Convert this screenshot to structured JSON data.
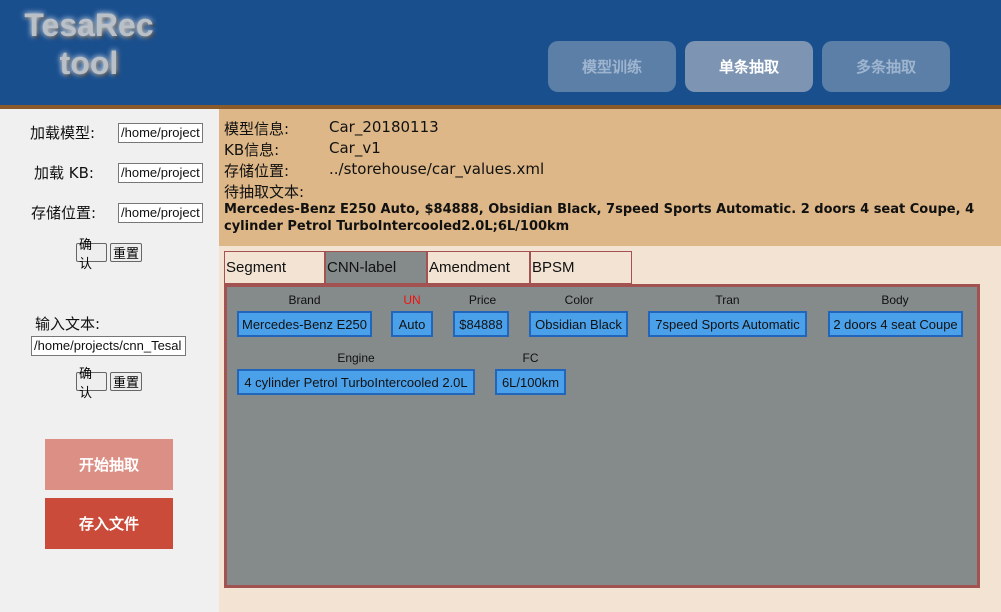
{
  "header": {
    "logo_line1": "TesaRec",
    "logo_line2": "tool",
    "nav_train": "模型训练",
    "nav_single": "单条抽取",
    "nav_multi": "多条抽取"
  },
  "left": {
    "load_model_label": "加载模型:",
    "load_model_value": "/home/project",
    "load_kb_label": "加载 KB:",
    "load_kb_value": "/home/project",
    "save_path_label": "存储位置:",
    "save_path_value": "/home/project",
    "confirm_label": "确认",
    "reset_label": "重置",
    "input_text_label": "输入文本:",
    "input_text_value": "/home/projects/cnn_Tesal",
    "confirm2_label": "确认",
    "reset2_label": "重置",
    "start_extract": "开始抽取",
    "save_file": "存入文件"
  },
  "info": {
    "model_label": "模型信息:",
    "model_value": "Car_20180113",
    "kb_label": "KB信息:",
    "kb_value": "Car_v1",
    "store_label": "存储位置:",
    "store_value": "../storehouse/car_values.xml",
    "text_label": "待抽取文本:",
    "text_value": "Mercedes-Benz E250 Auto, $84888, Obsidian Black, 7speed Sports Automatic. 2 doors 4 seat Coupe, 4 cylinder Petrol TurboIntercooled2.0L;6L/100km"
  },
  "tabs": {
    "segment": "Segment",
    "cnn": "CNN-label",
    "amendment": "Amendment",
    "bpsm": "BPSM"
  },
  "fields": {
    "brand": {
      "label": "Brand",
      "value": "Mercedes-Benz E250"
    },
    "un": {
      "label": "UN",
      "value": "Auto"
    },
    "price": {
      "label": "Price",
      "value": "$84888"
    },
    "color": {
      "label": "Color",
      "value": "Obsidian Black"
    },
    "tran": {
      "label": "Tran",
      "value": "7speed Sports Automatic"
    },
    "body": {
      "label": "Body",
      "value": "2 doors 4 seat Coupe"
    },
    "engine": {
      "label": "Engine",
      "value": "4 cylinder Petrol TurboIntercooled 2.0L"
    },
    "fc": {
      "label": "FC",
      "value": "6L/100km"
    }
  },
  "colors": {
    "header_bg": "#1a4f8e",
    "info_bg": "#ddb787",
    "canvas_bg": "#848b8a",
    "chip_bg": "#4aa1ea",
    "start_btn": "#dc8f85",
    "save_btn": "#cb4b3a",
    "un_label": "#ee1111"
  }
}
